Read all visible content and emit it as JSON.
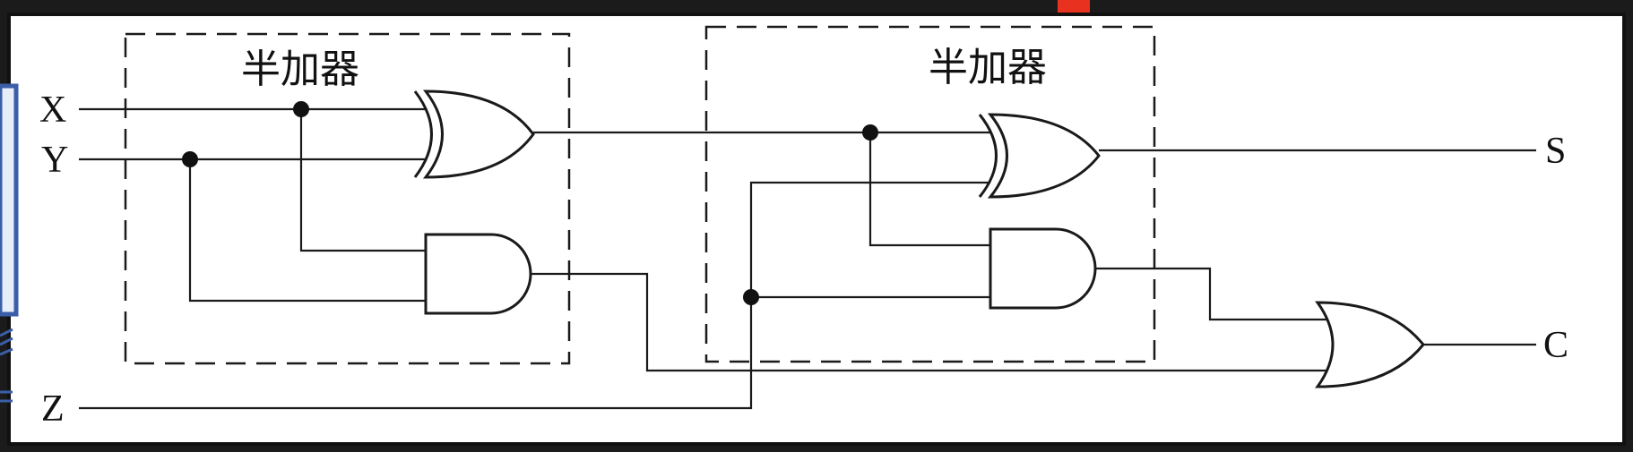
{
  "blocks": {
    "half_adder_1": {
      "label": "半加器"
    },
    "half_adder_2": {
      "label": "半加器"
    }
  },
  "inputs": {
    "x": "X",
    "y": "Y",
    "z": "Z"
  },
  "outputs": {
    "s": "S",
    "c": "C"
  },
  "colors": {
    "background": "#ffffff",
    "line": "#1a1a1a",
    "frame": "#111111",
    "page_backdrop": "#1b1b1b",
    "left_panel": "#e6eef8",
    "left_panel_border": "#3a5fa8",
    "red_marker": "#e8321f"
  }
}
